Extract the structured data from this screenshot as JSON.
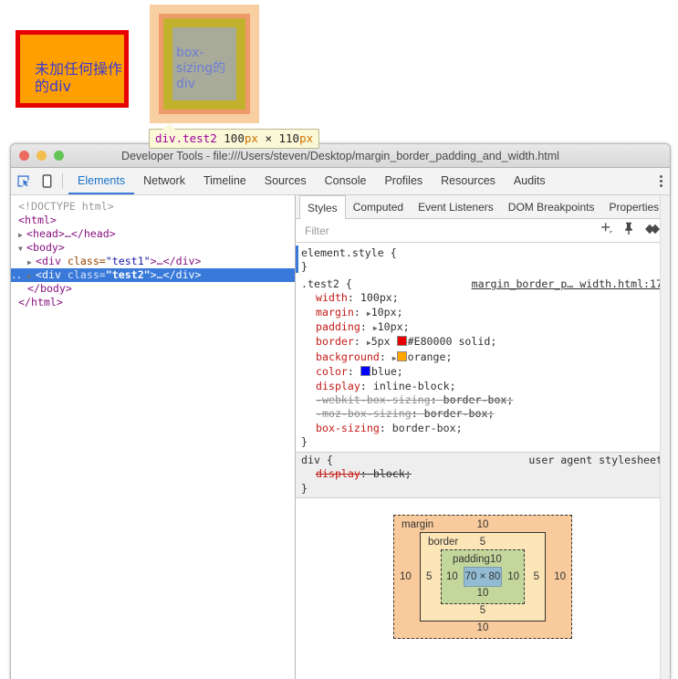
{
  "page": {
    "test1_div": {
      "text": "未加任何操作的div",
      "background": "#ffa000",
      "border_color": "#E80000",
      "text_color": "#3a3ad0"
    },
    "test2_div": {
      "text": "box-sizing的div",
      "highlight": {
        "margin_color": "#f7cfa0",
        "border_color": "#ef9a6a",
        "padding_color": "#c2b12c",
        "content_color": "#a8aa9a"
      }
    },
    "highlight_tooltip": {
      "selector": "div.test2",
      "width_value": "100",
      "unit": "px",
      "separator": "×",
      "height_value": "110"
    }
  },
  "window": {
    "title": "Developer Tools - file:///Users/steven/Desktop/margin_border_padding_and_width.html",
    "traffic_lights": [
      "close-button",
      "minimize-button",
      "maximize-button"
    ]
  },
  "toolbar": {
    "inspect_icon": "inspect-element-icon",
    "device_icon": "device-toolbar-icon",
    "menu_icon": "more-options-icon",
    "tabs": [
      {
        "label": "Elements",
        "active": true
      },
      {
        "label": "Network",
        "active": false
      },
      {
        "label": "Timeline",
        "active": false
      },
      {
        "label": "Sources",
        "active": false
      },
      {
        "label": "Console",
        "active": false
      },
      {
        "label": "Profiles",
        "active": false
      },
      {
        "label": "Resources",
        "active": false
      },
      {
        "label": "Audits",
        "active": false
      }
    ]
  },
  "dom_tree": {
    "rows": [
      {
        "kind": "doctype",
        "text": "<!DOCTYPE html>"
      },
      {
        "kind": "tag",
        "text": "<html>"
      },
      {
        "kind": "collapsed",
        "text": "<head>…</head>"
      },
      {
        "kind": "open",
        "text": "<body>"
      },
      {
        "kind": "child",
        "tag_open": "<div ",
        "attr": "class=",
        "value": "\"test1\"",
        "tag_close": ">…</div>"
      },
      {
        "kind": "child-selected",
        "tag_open": "<div ",
        "attr": "class=",
        "value": "\"test2\"",
        "tag_close": ">…</div>"
      },
      {
        "kind": "close",
        "text": "</body>"
      },
      {
        "kind": "close",
        "text": "</html>"
      }
    ],
    "test1_line": {
      "tag_open": "<div ",
      "attr": "class=",
      "value": "\"test1\"",
      "tag_close": ">…</div>"
    },
    "test2_line": {
      "tag_open": "<div ",
      "attr": "class=",
      "value": "\"test2\"",
      "tag_close": ">…</div>"
    },
    "doctype_text": "<!DOCTYPE html>",
    "html_open": "<html>",
    "head_text": "<head>…</head>",
    "body_open": "<body>",
    "body_close": "</body>",
    "html_close": "</html>"
  },
  "styles_panel": {
    "tabs": [
      {
        "label": "Styles",
        "active": true
      },
      {
        "label": "Computed",
        "active": false
      },
      {
        "label": "Event Listeners",
        "active": false
      },
      {
        "label": "DOM Breakpoints",
        "active": false
      },
      {
        "label": "Properties",
        "active": false
      }
    ],
    "filter_placeholder": "Filter",
    "filter_value": "",
    "filter_icons": [
      "new-style-rule-icon",
      "pin-icon",
      "element-state-icon"
    ],
    "rules": {
      "element_style": {
        "selector": "element.style {",
        "close": "}"
      },
      "test2": {
        "selector": ".test2 {",
        "source": "margin_border_p… width.html:17",
        "close": "}",
        "declarations": [
          {
            "name": "width",
            "value": "100px;",
            "expandable": false,
            "struck": false
          },
          {
            "name": "margin",
            "value": "10px;",
            "expandable": true,
            "struck": false
          },
          {
            "name": "padding",
            "value": "10px;",
            "expandable": true,
            "struck": false
          },
          {
            "name": "border",
            "value": "5px #E80000 solid;",
            "expandable": true,
            "struck": false,
            "swatch": "#E80000"
          },
          {
            "name": "background",
            "value": "orange;",
            "expandable": true,
            "struck": false,
            "swatch": "#ffa500"
          },
          {
            "name": "color",
            "value": "blue;",
            "expandable": false,
            "struck": false,
            "swatch": "#0000ff"
          },
          {
            "name": "display",
            "value": "inline-block;",
            "expandable": false,
            "struck": false
          },
          {
            "name": "-webkit-box-sizing",
            "value": "border-box;",
            "expandable": false,
            "struck": true
          },
          {
            "name": "-moz-box-sizing",
            "value": "border-box;",
            "expandable": false,
            "struck": true
          },
          {
            "name": "box-sizing",
            "value": "border-box;",
            "expandable": false,
            "struck": false
          }
        ]
      },
      "div_ua": {
        "selector": "div {",
        "source_label": "user agent stylesheet",
        "close": "}",
        "declaration": {
          "name": "display",
          "value": "block;",
          "struck": true
        }
      }
    }
  },
  "box_model": {
    "margin_label": "margin",
    "margin_top": "10",
    "margin_bottom": "10",
    "margin_left": "10",
    "margin_right": "10",
    "border_label": "border",
    "border_top": "5",
    "border_bottom": "5",
    "border_left": "5",
    "border_right": "5",
    "padding_label": "padding",
    "padding_top": "10",
    "padding_bottom": "10",
    "padding_left": "10",
    "padding_right": "10",
    "content_size": "70 × 80",
    "colors": {
      "margin": "#f9cb9c",
      "border": "#fce5b6",
      "padding": "#c3d69b",
      "content": "#93bcd4"
    }
  }
}
